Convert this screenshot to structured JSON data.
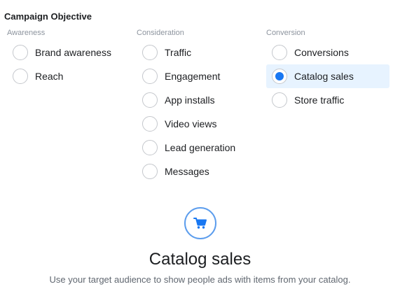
{
  "title": "Campaign Objective",
  "columns": [
    {
      "header": "Awareness",
      "options": [
        {
          "label": "Brand awareness",
          "selected": false
        },
        {
          "label": "Reach",
          "selected": false
        }
      ]
    },
    {
      "header": "Consideration",
      "options": [
        {
          "label": "Traffic",
          "selected": false
        },
        {
          "label": "Engagement",
          "selected": false
        },
        {
          "label": "App installs",
          "selected": false
        },
        {
          "label": "Video views",
          "selected": false
        },
        {
          "label": "Lead generation",
          "selected": false
        },
        {
          "label": "Messages",
          "selected": false
        }
      ]
    },
    {
      "header": "Conversion",
      "options": [
        {
          "label": "Conversions",
          "selected": false
        },
        {
          "label": "Catalog sales",
          "selected": true
        },
        {
          "label": "Store traffic",
          "selected": false
        }
      ]
    }
  ],
  "detail": {
    "icon": "shopping-cart-icon",
    "title": "Catalog sales",
    "description": "Use your target audience to show people ads with items from your catalog."
  },
  "colors": {
    "accent": "#1877f2",
    "selected_background": "#e7f3ff",
    "icon_ring": "#5c9ded",
    "header_text": "#8d949e"
  }
}
